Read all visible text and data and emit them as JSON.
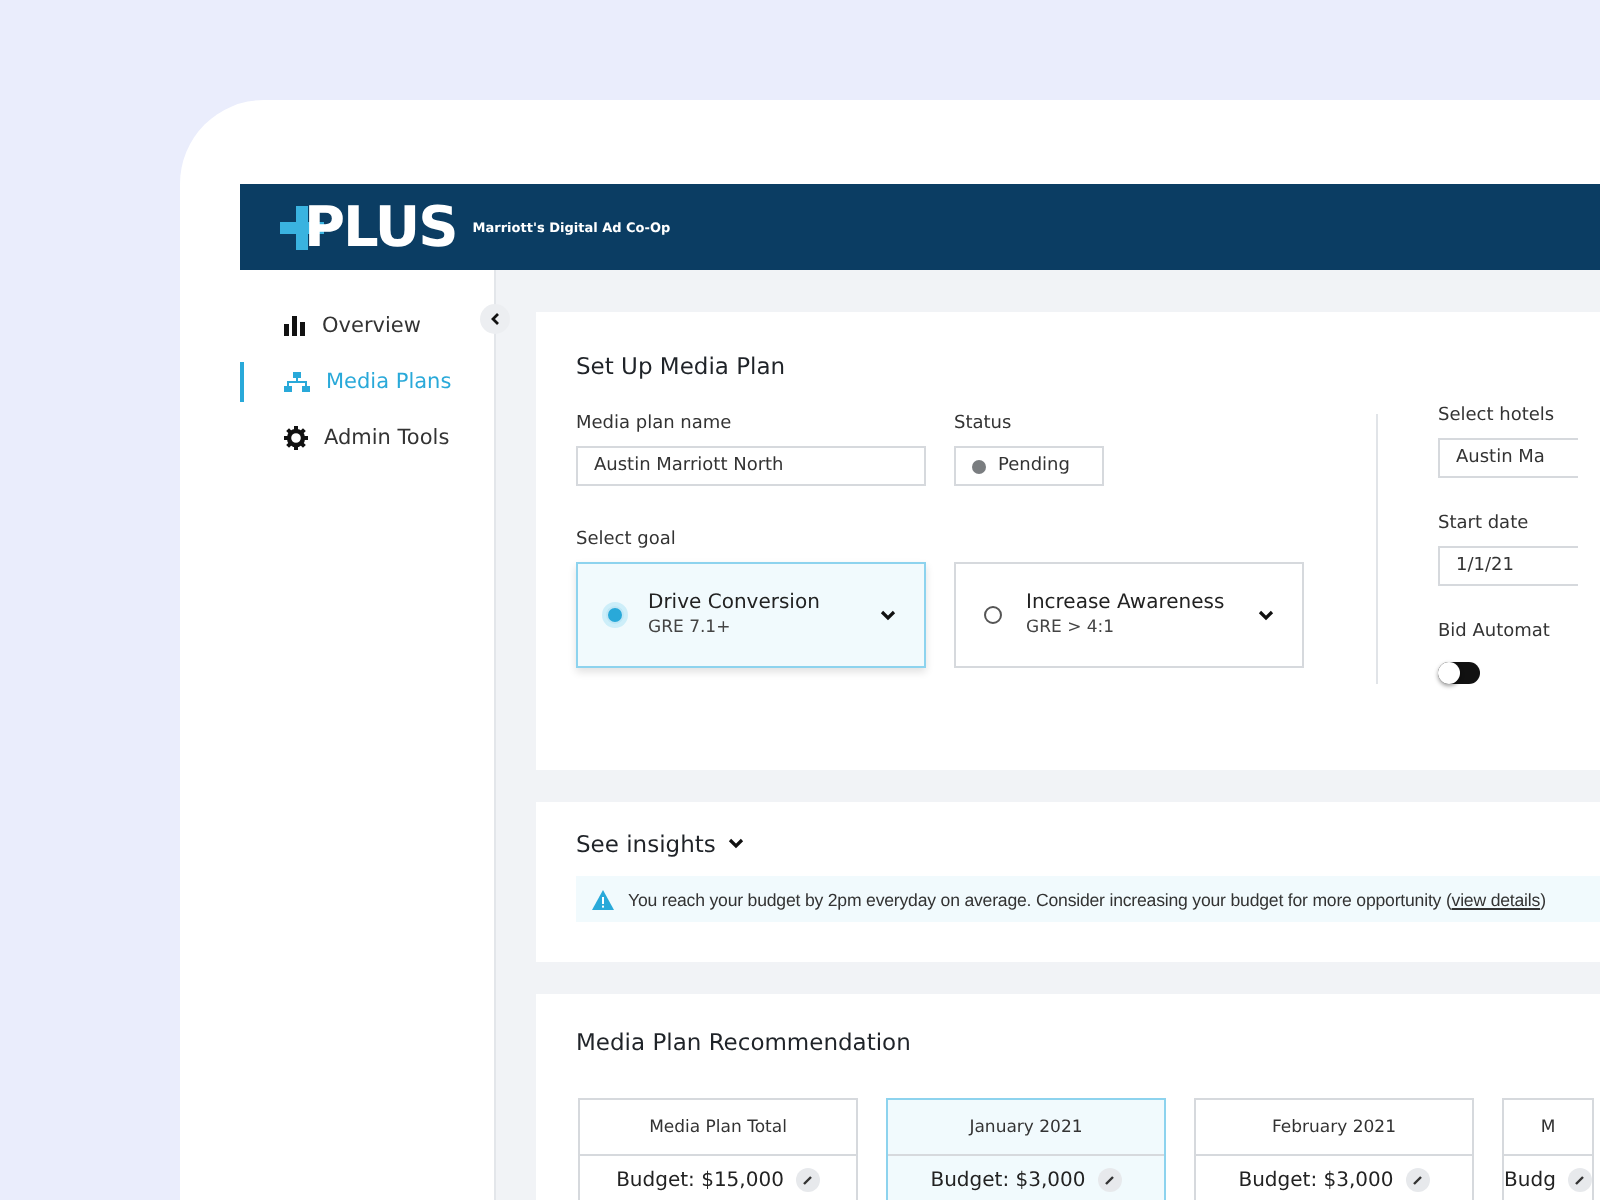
{
  "header": {
    "logo": "PLUS",
    "tagline": "Marriott's Digital Ad Co-Op"
  },
  "sidebar": {
    "items": [
      {
        "label": "Overview",
        "selected": false
      },
      {
        "label": "Media Plans",
        "selected": true
      },
      {
        "label": "Admin Tools",
        "selected": false
      }
    ]
  },
  "setup": {
    "title": "Set Up Media Plan",
    "name_field": {
      "label": "Media plan name",
      "value": "Austin Marriott North"
    },
    "status_field": {
      "label": "Status",
      "value": "Pending"
    },
    "goal_label": "Select goal",
    "goals": [
      {
        "title": "Drive Conversion",
        "subtitle": "GRE 7.1+",
        "selected": true
      },
      {
        "title": "Increase Awareness",
        "subtitle": "GRE > 4:1",
        "selected": false
      }
    ],
    "hotels_field": {
      "label": "Select hotels",
      "value": "Austin Ma"
    },
    "start_field": {
      "label": "Start date",
      "value": "1/1/21"
    },
    "bid": {
      "label": "Bid Automat",
      "on": false
    }
  },
  "insights": {
    "title": "See insights",
    "message": "You reach your budget by 2pm everyday on average. Consider increasing your budget for more opportunity (",
    "link": "view details",
    "message_end": ")"
  },
  "recommendation": {
    "title": "Media Plan Recommendation",
    "columns": [
      {
        "title": "Media Plan Total",
        "budget": "Budget: $15,000",
        "selected": false
      },
      {
        "title": "January 2021",
        "budget": "Budget: $3,000",
        "selected": true
      },
      {
        "title": "February 2021",
        "budget": "Budget: $3,000",
        "selected": false
      },
      {
        "title": "M",
        "budget": "Budg",
        "selected": false
      }
    ]
  }
}
